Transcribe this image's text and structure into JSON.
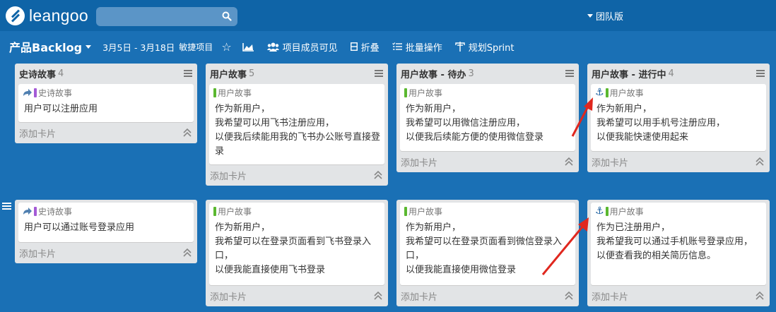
{
  "app": {
    "logo_text": "leangoo",
    "team_label": "团队版"
  },
  "search": {
    "placeholder": ""
  },
  "board": {
    "title": "产品Backlog",
    "dates": "3月5日 - 3月18日",
    "project_type": "敏捷项目",
    "tools": {
      "members_visible": "项目成员可见",
      "fold": "折叠",
      "batch": "批量操作",
      "plan_sprint": "规划Sprint"
    }
  },
  "colors": {
    "epic": "#a45bd6",
    "story": "#5bb830",
    "arrow": "#e0271e",
    "anchor": "#1a5fa0"
  },
  "add_card_label": "添加卡片",
  "lists": [
    {
      "title": "史诗故事",
      "count": "4"
    },
    {
      "title": "用户故事",
      "count": "5"
    },
    {
      "title": "用户故事 - 待办",
      "count": "3"
    },
    {
      "title": "用户故事 - 进行中",
      "count": "4"
    }
  ],
  "cards": {
    "r1c1": {
      "tag": "史诗故事",
      "text": "用户可以注册应用"
    },
    "r1c2": {
      "tag": "用户故事",
      "text": "作为新用户，\n我希望可以用飞书注册应用，\n以便我后续能用我的飞书办公账号直接登录"
    },
    "r1c3": {
      "tag": "用户故事",
      "text": "作为新用户，\n我希望可以用微信注册应用，\n以便我后续能方便的使用微信登录"
    },
    "r1c4": {
      "tag": "用户故事",
      "text": "作为新用户，\n我希望可以用手机号注册应用，\n以便我能快速使用起来"
    },
    "r2c1": {
      "tag": "史诗故事",
      "text": "用户可以通过账号登录应用"
    },
    "r2c2": {
      "tag": "用户故事",
      "text": "作为新用户，\n我希望可以在登录页面看到飞书登录入口，\n以便我能直接使用飞书登录"
    },
    "r2c3": {
      "tag": "用户故事",
      "text": "作为新用户，\n我希望可以在登录页面看到微信登录入口，\n以便我能直接使用微信登录"
    },
    "r2c4": {
      "tag": "用户故事",
      "text": "作为已注册用户，\n我希望我可以通过手机账号登录应用，\n以便查看我的相关简历信息。"
    }
  }
}
